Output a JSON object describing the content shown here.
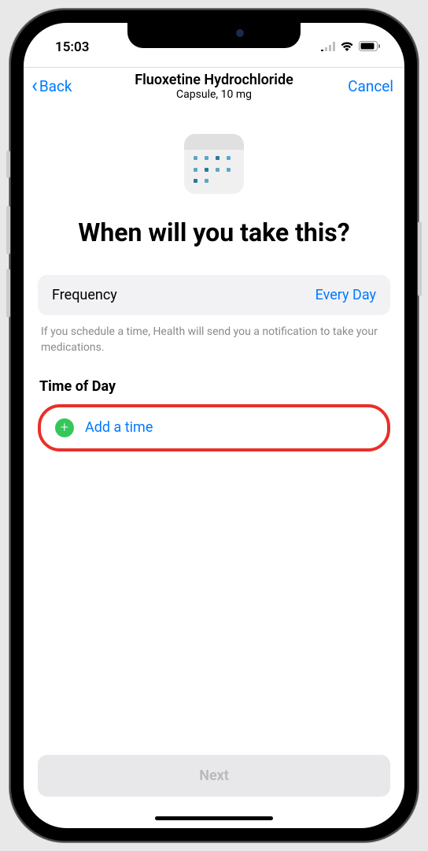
{
  "status": {
    "time": "15:03"
  },
  "nav": {
    "back_label": "Back",
    "title": "Fluoxetine Hydrochloride",
    "subtitle": "Capsule, 10 mg",
    "cancel_label": "Cancel"
  },
  "prompt": {
    "heading": "When will you take this?"
  },
  "frequency": {
    "label": "Frequency",
    "value": "Every Day"
  },
  "info_text": "If you schedule a time, Health will send you a notification to take your medications.",
  "time_section": {
    "header": "Time of Day",
    "add_label": "Add a time"
  },
  "footer": {
    "next_label": "Next"
  }
}
